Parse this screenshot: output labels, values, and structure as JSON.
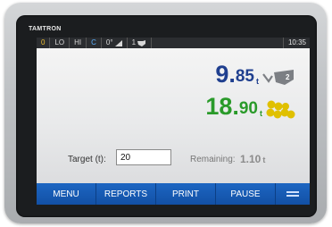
{
  "device": {
    "brand": "TAMTRON"
  },
  "status_bar": {
    "zero": "0",
    "lo": "LO",
    "hi": "HI",
    "mode": "C",
    "tilt": "0°",
    "count": "1",
    "clock": "10:35"
  },
  "weights": {
    "primary": {
      "integer": "9.",
      "decimal": "85",
      "unit": "t",
      "icon": "bucket-2-icon",
      "color": "#1f3f8f"
    },
    "total": {
      "integer": "18.",
      "decimal": "90",
      "unit": "t",
      "icon": "pile-icon",
      "color": "#2a9a2a"
    }
  },
  "target": {
    "label": "Target (t):",
    "value": "20"
  },
  "remaining": {
    "label": "Remaining:",
    "value": "1.10",
    "unit": "t"
  },
  "menu": {
    "items": [
      "MENU",
      "REPORTS",
      "PRINT",
      "PAUSE"
    ],
    "more_icon": "menu-lines-icon"
  },
  "colors": {
    "menu_bar": "#1d66c2",
    "status_bar": "#2b2d30",
    "zero_indicator": "#f0c030",
    "mode_indicator": "#5ab0ff"
  }
}
